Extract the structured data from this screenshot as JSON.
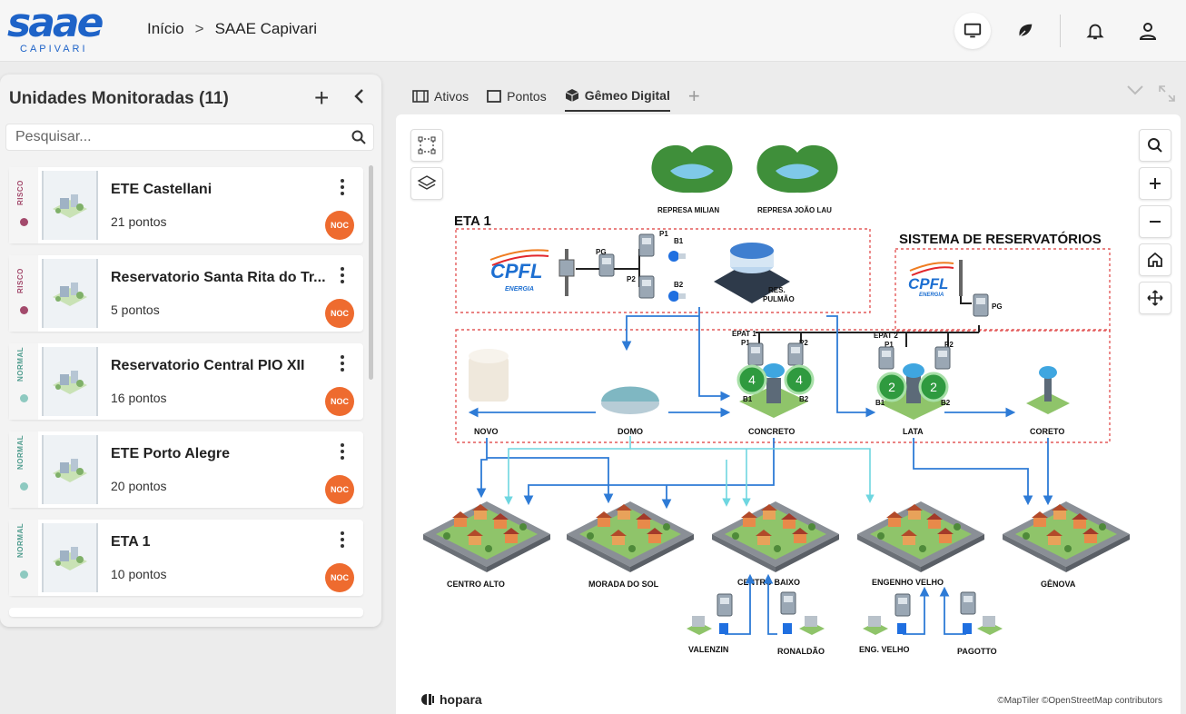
{
  "header": {
    "logo_text": "saae",
    "logo_subtext": "CAPIVARI",
    "breadcrumb": {
      "home": "Início",
      "separator": ">",
      "current": "SAAE Capivari"
    }
  },
  "sidebar": {
    "title": "Unidades Monitoradas (11)",
    "search_placeholder": "Pesquisar...",
    "items": [
      {
        "name": "ETE Castellani",
        "count": "21 pontos",
        "status": "RISCO",
        "badge": "NOC"
      },
      {
        "name": "Reservatorio Santa Rita do Tr...",
        "count": "5 pontos",
        "status": "RISCO",
        "badge": "NOC"
      },
      {
        "name": "Reservatorio Central PIO XII",
        "count": "16 pontos",
        "status": "NORMAL",
        "badge": "NOC"
      },
      {
        "name": "ETE Porto Alegre",
        "count": "20 pontos",
        "status": "NORMAL",
        "badge": "NOC"
      },
      {
        "name": "ETA 1",
        "count": "10 pontos",
        "status": "NORMAL",
        "badge": "NOC"
      }
    ]
  },
  "tabs": [
    {
      "label": "Ativos",
      "icon": "film-icon",
      "active": false
    },
    {
      "label": "Pontos",
      "icon": "square-icon",
      "active": false
    },
    {
      "label": "Gêmeo Digital",
      "icon": "cube-icon",
      "active": true
    }
  ],
  "diagram": {
    "section_eta": "ETA 1",
    "section_reservatorios": "SISTEMA DE RESERVATÓRIOS",
    "cpfl_brand": "CPFL",
    "cpfl_sub": "ENERGIA",
    "labels": {
      "represa_milian": "REPRESA MILIAN",
      "represa_joao_lau": "REPRESA JOÃO LAU",
      "pg": "PG",
      "p1": "P1",
      "p2": "P2",
      "b1": "B1",
      "b2": "B2",
      "res_pulmao_1": "RES.",
      "res_pulmao_2": "PULMÃO",
      "epat1": "EPAT 1",
      "epat2": "EPAT 2",
      "novo": "NOVO",
      "domo": "DOMO",
      "concreto": "CONCRETO",
      "lata": "LATA",
      "coreto": "CORETO",
      "centro_alto": "CENTRO ALTO",
      "morada_do_sol": "MORADA DO SOL",
      "centro_baixo": "CENTRO BAIXO",
      "engenho_velho": "ENGENHO VELHO",
      "genova": "GÊNOVA",
      "valenzin": "VALENZIN",
      "ronaldao": "RONALDÃO",
      "eng_velho": "ENG. VELHO",
      "pagotto": "PAGOTTO"
    },
    "counts": {
      "concreto_p1": "4",
      "concreto_p2": "4",
      "lata_p1": "2",
      "lata_p2": "2"
    }
  },
  "footer": {
    "brand": "hopara",
    "attribution": "©MapTiler ©OpenStreetMap contributors"
  },
  "colors": {
    "accent_blue": "#1e63c8",
    "risk": "#a34a6c",
    "normal": "#4f9c8e",
    "noc": "#ee6b2f",
    "pipe_blue": "#2e7bd6",
    "pipe_cyan": "#6ed6e0",
    "dashed_red": "#e35a5a"
  }
}
